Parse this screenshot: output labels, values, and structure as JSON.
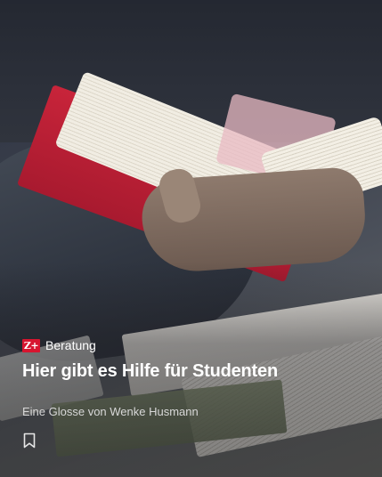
{
  "article": {
    "badge": "Z+",
    "section": "Beratung",
    "title": "Hier gibt es Hilfe für Studenten",
    "byline": "Eine Glosse von Wenke Husmann"
  },
  "colors": {
    "badge_bg": "#d7152f",
    "text": "#ffffff"
  },
  "icons": {
    "bookmark": "bookmark-icon"
  }
}
